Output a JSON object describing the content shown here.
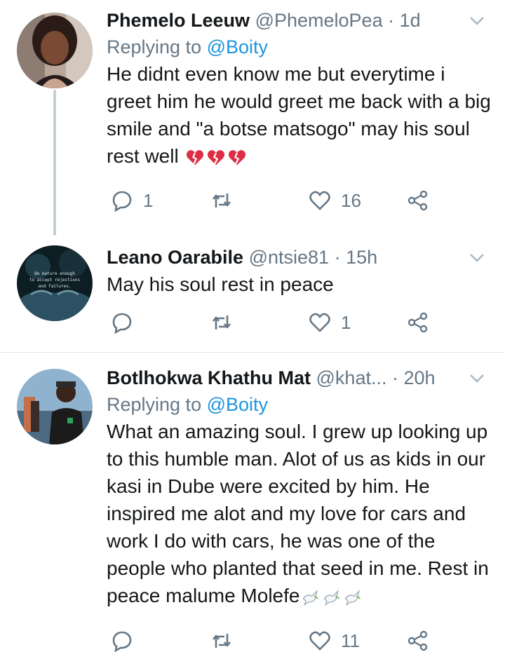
{
  "tweets": [
    {
      "name": "Phemelo Leeuw",
      "handle": "@PhemeloPea",
      "time": "· 1d",
      "replying_prefix": "Replying to",
      "replying_handle": "@Boity",
      "text": "He didnt even know me but everytime i greet him he would greet me back with a big smile and \"a botse matsogo\" may his soul rest well",
      "emoji": "broken-heart x3",
      "replies": "1",
      "retweets": "",
      "likes": "16"
    },
    {
      "name": "Leano Oarabile",
      "handle": "@ntsie81",
      "time": "· 15h",
      "text": "May his soul rest in peace",
      "avatar_text": "Be mature enough to accept rejections and failures.",
      "replies": "",
      "retweets": "",
      "likes": "1"
    },
    {
      "name": "Botlhokwa Khathu Mat",
      "handle": "@khat...",
      "time": "· 20h",
      "replying_prefix": "Replying to",
      "replying_handle": "@Boity",
      "text": "What an amazing soul. I grew up looking up to this humble man. Alot of us as kids in our kasi in Dube were excited by him. He inspired me alot and my love for cars and work I do with cars, he was one of the people who planted that seed in me. Rest in peace malume Molefe",
      "emoji": "dove x3",
      "replies": "",
      "retweets": "",
      "likes": "11"
    }
  ],
  "colors": {
    "name": "#14171a",
    "meta": "#657786",
    "link": "#1b95e0",
    "thread": "#c4cfd6",
    "divider": "#e1e8ed"
  }
}
